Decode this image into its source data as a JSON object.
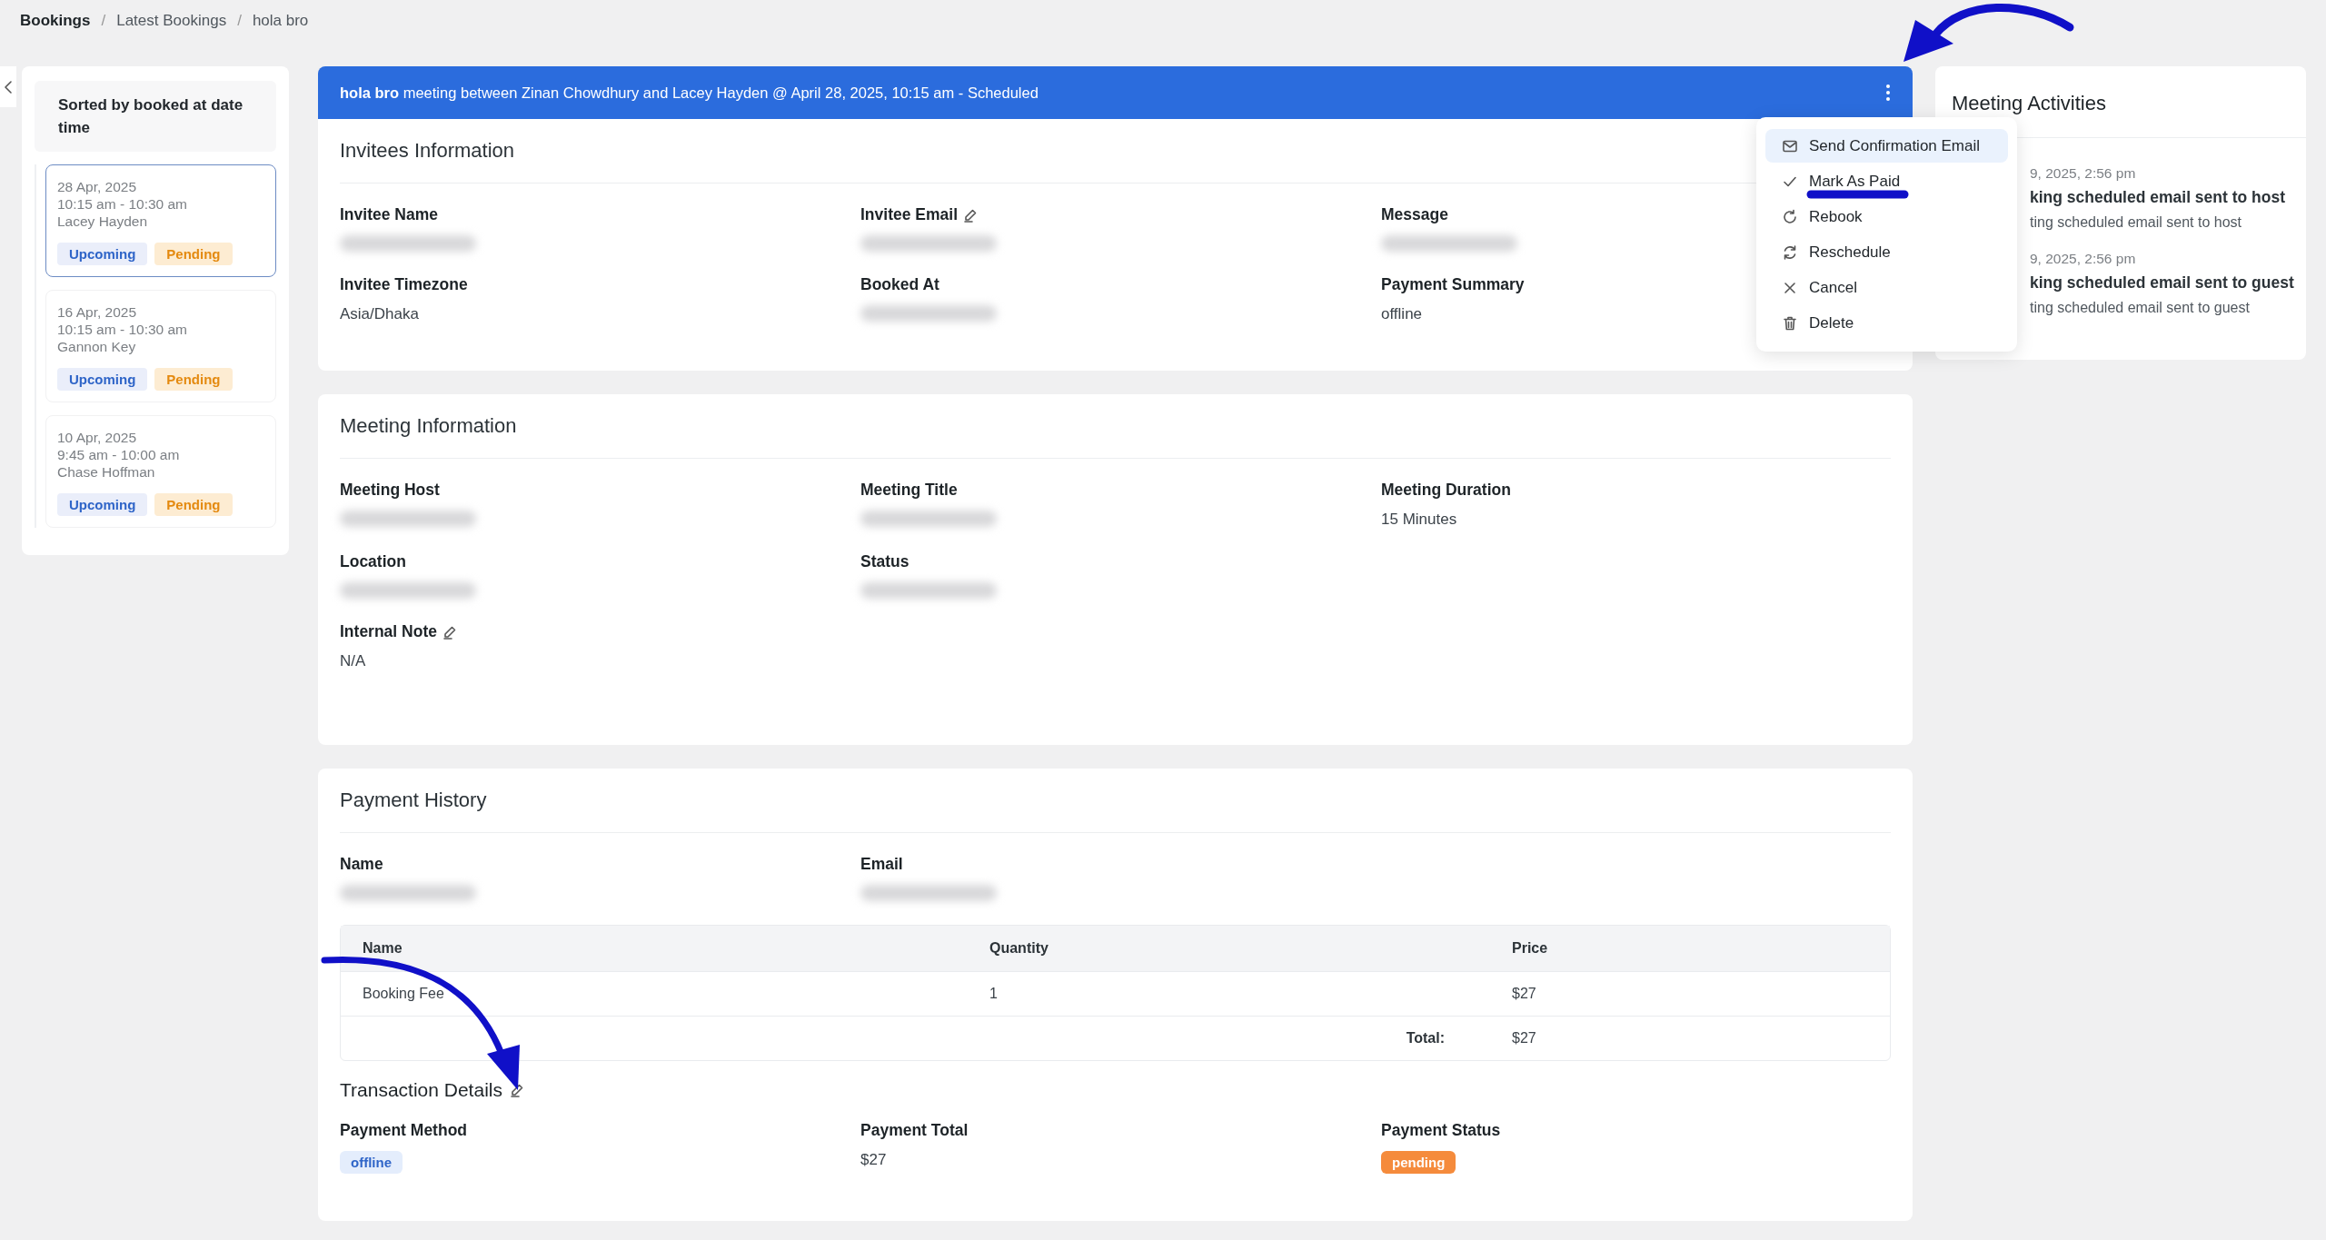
{
  "breadcrumb": {
    "items": [
      "Bookings",
      "Latest Bookings",
      "hola bro"
    ],
    "separator": "/"
  },
  "sidebar": {
    "title": "Sorted by booked at date time",
    "bookings": [
      {
        "date": "28 Apr, 2025",
        "time": "10:15 am - 10:30 am",
        "name": "Lacey Hayden",
        "selected": true,
        "tags": [
          {
            "label": "Upcoming",
            "kind": "upcoming"
          },
          {
            "label": "Pending",
            "kind": "pending"
          }
        ]
      },
      {
        "date": "16 Apr, 2025",
        "time": "10:15 am - 10:30 am",
        "name": "Gannon Key",
        "selected": false,
        "tags": [
          {
            "label": "Upcoming",
            "kind": "upcoming"
          },
          {
            "label": "Pending",
            "kind": "pending"
          }
        ]
      },
      {
        "date": "10 Apr, 2025",
        "time": "9:45 am - 10:00 am",
        "name": "Chase Hoffman",
        "selected": false,
        "tags": [
          {
            "label": "Upcoming",
            "kind": "upcoming"
          },
          {
            "label": "Pending",
            "kind": "pending"
          }
        ]
      }
    ]
  },
  "header": {
    "title": "**hola bro** meeting between Zinan Chowdhury and Lacey Hayden @ April 28, 2025, 10:15 am - Scheduled"
  },
  "menu": {
    "items": [
      {
        "label": "Send Confirmation Email",
        "kind": "email",
        "selected": true
      },
      {
        "label": "Mark As Paid",
        "kind": "check",
        "selected": false
      },
      {
        "label": "Rebook",
        "kind": "rebook",
        "selected": false
      },
      {
        "label": "Reschedule",
        "kind": "reschedule",
        "selected": false
      },
      {
        "label": "Cancel",
        "kind": "cancel",
        "selected": false
      },
      {
        "label": "Delete",
        "kind": "delete",
        "selected": false
      }
    ]
  },
  "invitees": {
    "title": "Invitees Information",
    "rows": [
      [
        {
          "label": "Invitee Name",
          "blurred": true,
          "editable": false
        },
        {
          "label": "Invitee Email",
          "blurred": true,
          "editable": true
        },
        {
          "label": "Message",
          "blurred": true,
          "editable": false
        }
      ],
      [
        {
          "label": "Invitee Timezone",
          "value": "Asia/Dhaka",
          "editable": false
        },
        {
          "label": "Booked At",
          "blurred": true,
          "editable": false
        },
        {
          "label": "Payment Summary",
          "value": "offline",
          "editable": false
        }
      ]
    ]
  },
  "meeting": {
    "title": "Meeting Information",
    "rows": [
      [
        {
          "label": "Meeting Host",
          "blurred": true,
          "editable": false
        },
        {
          "label": "Meeting Title",
          "blurred": true,
          "editable": false
        },
        {
          "label": "Meeting Duration",
          "value": "15 Minutes",
          "editable": false
        }
      ],
      [
        {
          "label": "Location",
          "blurred": true,
          "editable": false
        },
        {
          "label": "Status",
          "blurred": true,
          "editable": false
        }
      ],
      [
        {
          "label": "Internal Note",
          "value": "N/A",
          "editable": true
        }
      ]
    ]
  },
  "payment": {
    "title": "Payment History",
    "rows": [
      [
        {
          "label": "Name",
          "blurred": true,
          "editable": false
        },
        {
          "label": "Email",
          "blurred": true,
          "editable": false
        }
      ]
    ],
    "table": {
      "columns": [
        "Name",
        "Quantity",
        "Price"
      ],
      "rows": [
        [
          "Booking Fee",
          "1",
          "$27"
        ]
      ],
      "total_label": "Total:",
      "total_value": "$27"
    },
    "transaction": {
      "title": "Transaction Details",
      "editable": true,
      "fields": [
        {
          "label": "Payment Method",
          "value": "offline",
          "kind": "info-tag"
        },
        {
          "label": "Payment Total",
          "value": "$27",
          "kind": "text"
        },
        {
          "label": "Payment Status",
          "value": "pending",
          "kind": "warning-tag"
        }
      ]
    }
  },
  "activities": {
    "title": "Meeting Activities",
    "entries": [
      {
        "time": "9, 2025, 2:56 pm",
        "title": "king scheduled email sent to host",
        "detail": "ting scheduled email sent to host"
      },
      {
        "time": "9, 2025, 2:56 pm",
        "title": "king scheduled email sent to guest",
        "detail": "ting scheduled email sent to guest"
      }
    ]
  }
}
